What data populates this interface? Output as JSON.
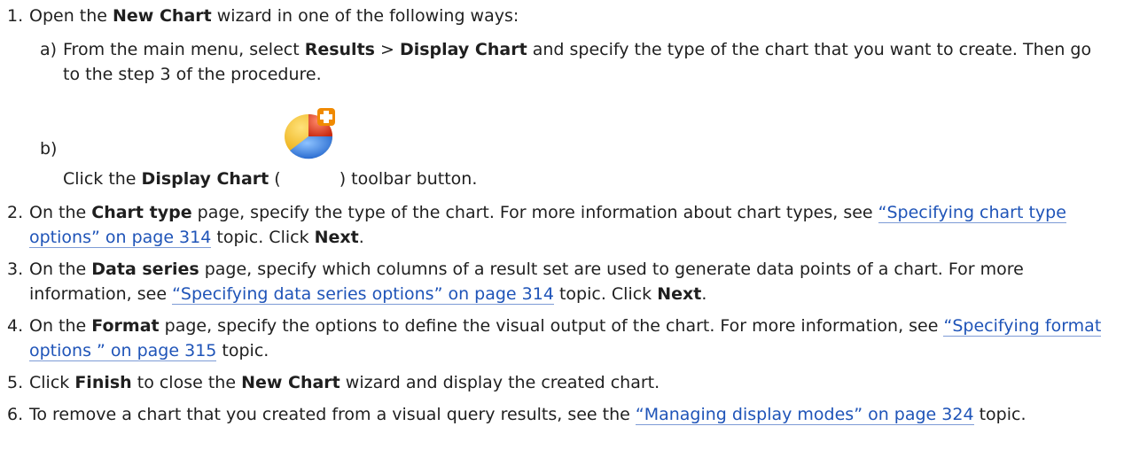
{
  "steps": [
    {
      "num": "1.",
      "t1": "Open the ",
      "b1": "New Chart",
      "t2": " wizard in one of the following ways:",
      "subs": [
        {
          "letter": "a)",
          "t1": "From the main menu, select ",
          "b1": "Results",
          "t2": " > ",
          "b2": "Display Chart",
          "t3": " and specify the type of the chart that you want to create. Then go to the step 3 of the procedure."
        },
        {
          "letter": "b)",
          "t1": "Click the ",
          "b1": "Display Chart",
          "t2": " (",
          "icon": "chart-add-icon",
          "t3": ") toolbar button."
        }
      ]
    },
    {
      "num": "2.",
      "t1": "On the ",
      "b1": "Chart type",
      "t2": " page, specify the type of the chart. For more information about chart types, see ",
      "link": "“Specifying chart type options” on page 314",
      "t3": " topic. Click ",
      "b2": "Next",
      "t4": "."
    },
    {
      "num": "3.",
      "t1": "On the ",
      "b1": "Data series",
      "t2": " page, specify which columns of a result set are used to generate data points of a chart. For more information, see ",
      "link": "“Specifying data series options” on page 314",
      "t3": " topic. Click ",
      "b2": "Next",
      "t4": "."
    },
    {
      "num": "4.",
      "t1": "On the ",
      "b1": "Format",
      "t2": " page, specify the options to define the visual output of the chart. For more information, see ",
      "link": "“Specifying format options ” on page 315",
      "t3": " topic."
    },
    {
      "num": "5.",
      "t1": "Click ",
      "b1": "Finish",
      "t2": " to close the ",
      "b2": "New Chart",
      "t3": " wizard and display the created chart."
    },
    {
      "num": "6.",
      "t1": "To remove a chart that you created from a visual query results, see the ",
      "link": "“Managing display modes” on page 324",
      "t2": " topic."
    }
  ],
  "colors": {
    "text": "#1f1f1f",
    "link": "#1f54b8",
    "link_underline": "#7d9bd6"
  }
}
